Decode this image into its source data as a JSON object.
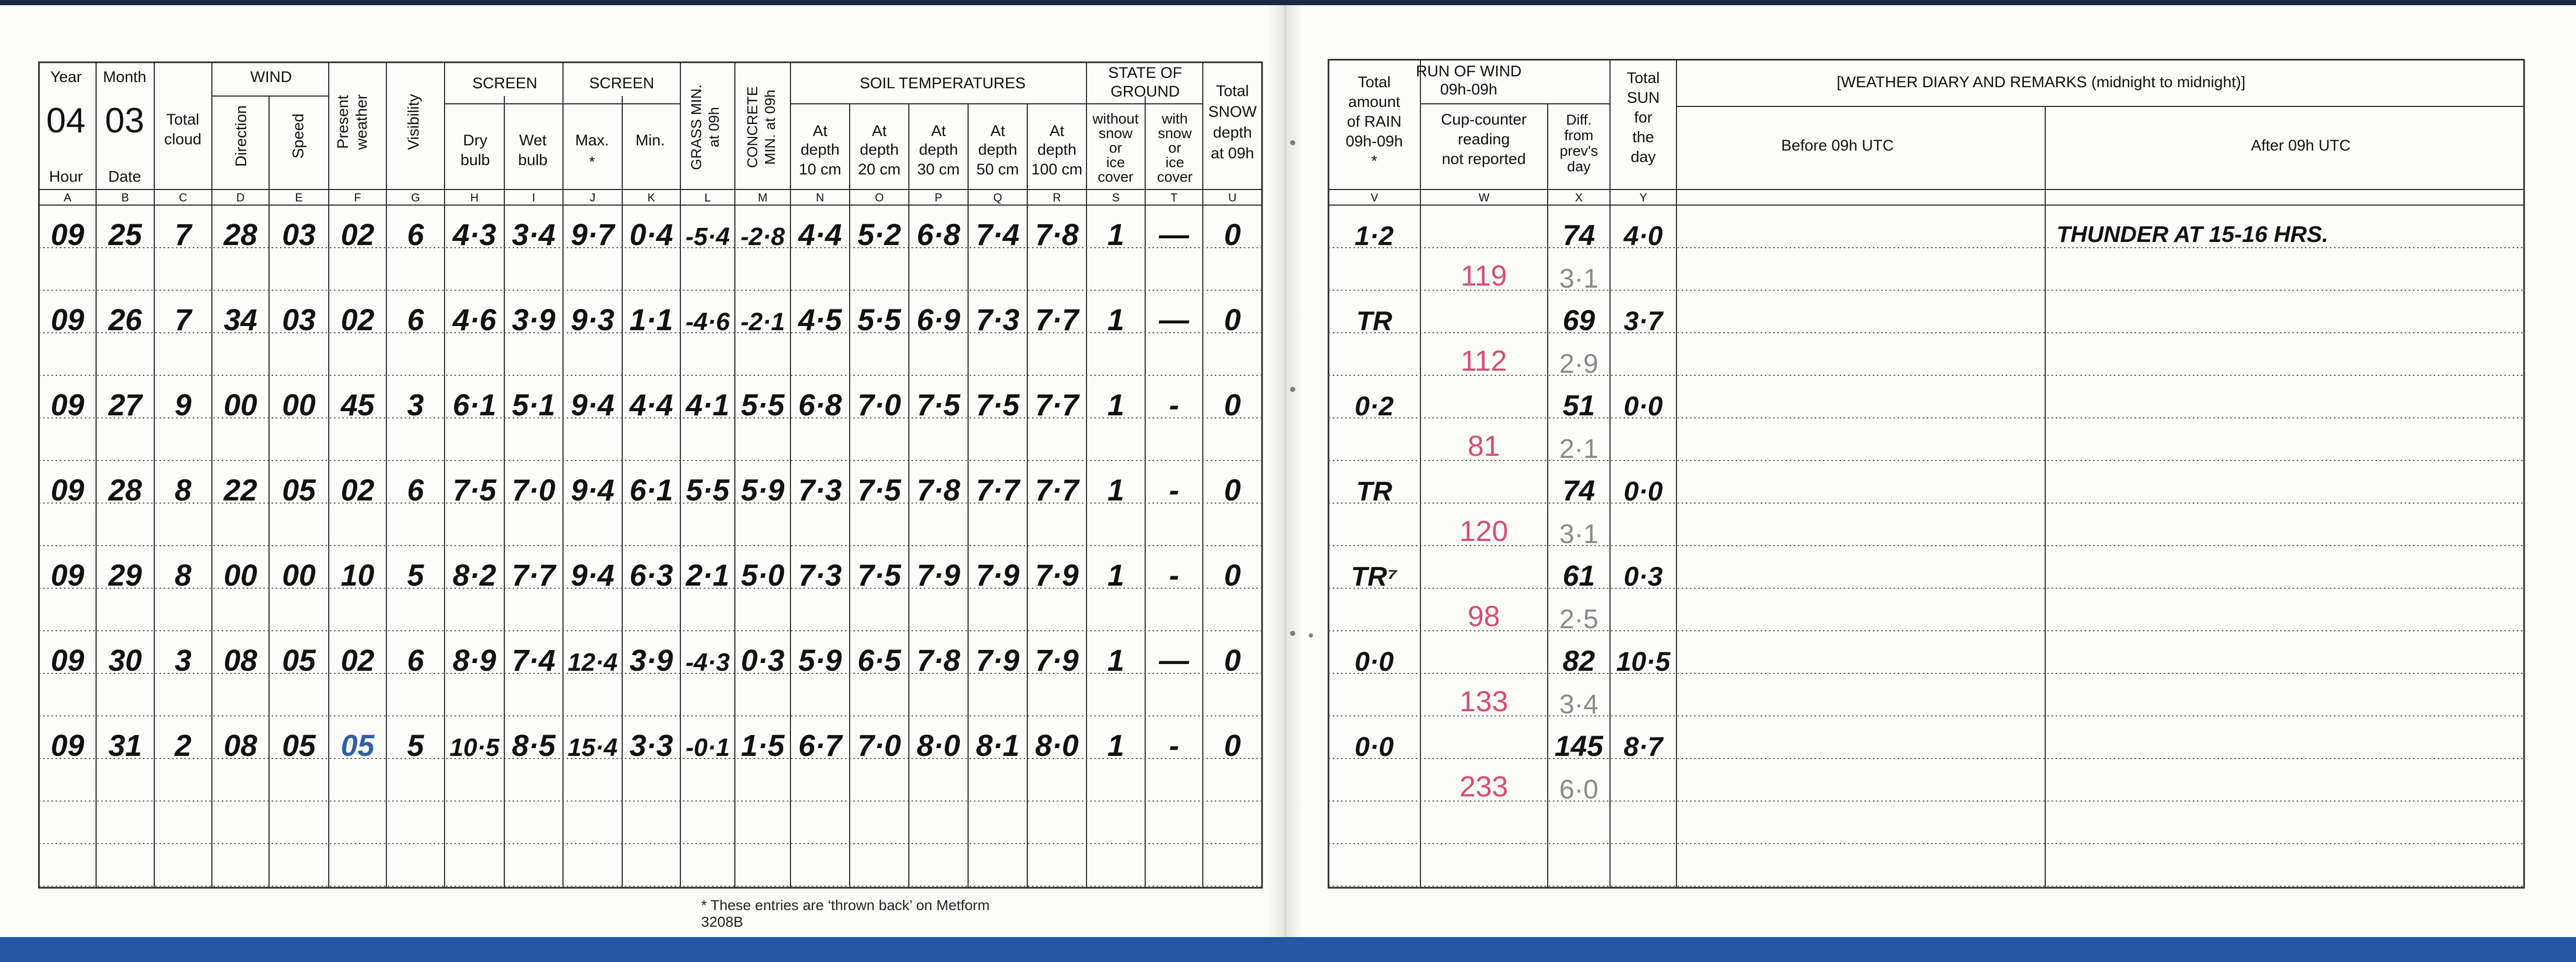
{
  "left_table": {
    "headers": {
      "year": "Year",
      "month": "Month",
      "year_value": "04",
      "month_value": "03",
      "hour": "Hour",
      "date": "Date",
      "total_cloud_1": "Total",
      "total_cloud_2": "cloud",
      "wind": "WIND",
      "direction": "Direction",
      "speed": "Speed",
      "present_weather_1": "Present",
      "present_weather_2": "weather",
      "visibility": "Visibility",
      "screen": "SCREEN",
      "dry_1": "Dry",
      "dry_2": "bulb",
      "wet_1": "Wet",
      "wet_2": "bulb",
      "screen2": "SCREEN",
      "max": "Max.",
      "star": "*",
      "min": "Min.",
      "grass_1": "GRASS MIN.",
      "grass_2": "at 09h",
      "concrete_1": "CONCRETE",
      "concrete_2": "MIN. at 09h",
      "soil": "SOIL TEMPERATURES",
      "at": "At",
      "depth": "depth",
      "d10": "10 cm",
      "d20": "20 cm",
      "d30": "30 cm",
      "d50": "50 cm",
      "d100": "100 cm",
      "state_1": "STATE OF",
      "state_2": "GROUND",
      "without": [
        "without",
        "snow",
        "or",
        "ice",
        "cover"
      ],
      "with": [
        "with",
        "snow",
        "or",
        "ice",
        "cover"
      ],
      "snow": [
        "Total",
        "SNOW",
        "depth",
        "at 09h"
      ]
    },
    "letters": [
      "A",
      "B",
      "C",
      "D",
      "E",
      "F",
      "G",
      "H",
      "I",
      "J",
      "K",
      "L",
      "M",
      "N",
      "O",
      "P",
      "Q",
      "R",
      "S",
      "T",
      "U"
    ],
    "rows": [
      [
        "09",
        "25",
        "7",
        "28",
        "03",
        "02",
        "6",
        "4·3",
        "3·4",
        "9·7",
        "0·4",
        "-5·4",
        "-2·8",
        "4·4",
        "5·2",
        "6·8",
        "7·4",
        "7·8",
        "1",
        "—",
        "0"
      ],
      [
        "09",
        "26",
        "7",
        "34",
        "03",
        "02",
        "6",
        "4·6",
        "3·9",
        "9·3",
        "1·1",
        "-4·6",
        "-2·1",
        "4·5",
        "5·5",
        "6·9",
        "7·3",
        "7·7",
        "1",
        "—",
        "0"
      ],
      [
        "09",
        "27",
        "9",
        "00",
        "00",
        "45",
        "3",
        "6·1",
        "5·1",
        "9·4",
        "4·4",
        "4·1",
        "5·5",
        "6·8",
        "7·0",
        "7·5",
        "7·5",
        "7·7",
        "1",
        "-",
        "0"
      ],
      [
        "09",
        "28",
        "8",
        "22",
        "05",
        "02",
        "6",
        "7·5",
        "7·0",
        "9·4",
        "6·1",
        "5·5",
        "5·9",
        "7·3",
        "7·5",
        "7·8",
        "7·7",
        "7·7",
        "1",
        "-",
        "0"
      ],
      [
        "09",
        "29",
        "8",
        "00",
        "00",
        "10",
        "5",
        "8·2",
        "7·7",
        "9·4",
        "6·3",
        "2·1",
        "5·0",
        "7·3",
        "7·5",
        "7·9",
        "7·9",
        "7·9",
        "1",
        "-",
        "0"
      ],
      [
        "09",
        "30",
        "3",
        "08",
        "05",
        "02",
        "6",
        "8·9",
        "7·4",
        "12·4",
        "3·9",
        "-4·3",
        "0·3",
        "5·9",
        "6·5",
        "7·8",
        "7·9",
        "7·9",
        "1",
        "—",
        "0"
      ],
      [
        "09",
        "31",
        "2",
        "08",
        "05",
        "05",
        "5",
        "10·5",
        "8·5",
        "15·4",
        "3·3",
        "-0·1",
        "1·5",
        "6·7",
        "7·0",
        "8·0",
        "8·1",
        "8·0",
        "1",
        "-",
        "0"
      ]
    ],
    "footnote": "* These entries are ‘thrown back’ on Metform 3208B"
  },
  "right_table": {
    "headers": {
      "rain": [
        "Total",
        "amount",
        "of RAIN",
        "09h-09h",
        "*"
      ],
      "run_of_wind_1": "RUN OF WIND",
      "run_of_wind_2": "09h-09h",
      "cup": [
        "Cup-counter",
        "reading",
        "not reported"
      ],
      "diff": [
        "Diff.",
        "from",
        "prev's",
        "day"
      ],
      "sun": [
        "Total",
        "SUN",
        "for",
        "the",
        "day"
      ],
      "diary": "[WEATHER DIARY AND REMARKS (midnight to midnight)]",
      "before": "Before 09h UTC",
      "after": "After 09h UTC"
    },
    "letters": [
      "V",
      "W",
      "X",
      "Y"
    ],
    "rows": [
      {
        "rain": "1·2",
        "diff": "74",
        "sun": "4·0",
        "cup": "119",
        "diff2": "3·1",
        "remark": "THUNDER AT 15-16 HRS."
      },
      {
        "rain": "TR",
        "diff": "69",
        "sun": "3·7",
        "cup": "112",
        "diff2": "2·9",
        "remark": ""
      },
      {
        "rain": "0·2",
        "diff": "51",
        "sun": "0·0",
        "cup": "81",
        "diff2": "2·1",
        "remark": ""
      },
      {
        "rain": "TR",
        "diff": "74",
        "sun": "0·0",
        "cup": "120",
        "diff2": "3·1",
        "remark": ""
      },
      {
        "rain": "TR⁷",
        "diff": "61",
        "sun": "0·3",
        "cup": "98",
        "diff2": "2·5",
        "remark": ""
      },
      {
        "rain": "0·0",
        "diff": "82",
        "sun": "10·5",
        "cup": "133",
        "diff2": "3·4",
        "remark": ""
      },
      {
        "rain": "0·0",
        "diff": "145",
        "sun": "8·7",
        "cup": "233",
        "diff2": "6·0",
        "remark": ""
      }
    ]
  },
  "colors": {
    "ink": "#111111",
    "pink": "#d94a78",
    "pencil": "#8a8a8a",
    "blue_ink": "#2f5fa8",
    "rule": "#222222"
  }
}
